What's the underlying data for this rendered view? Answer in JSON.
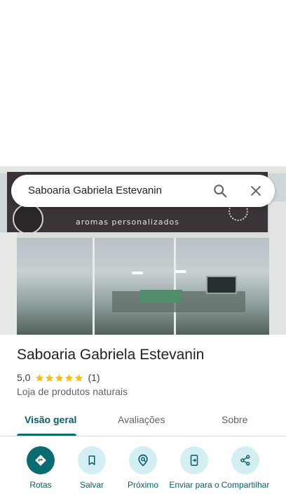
{
  "search": {
    "query": "Saboaria Gabriela Estevanin",
    "search_icon": "search-icon",
    "close_icon": "close-icon"
  },
  "photo": {
    "sign_text": "aromas personalizados"
  },
  "place": {
    "name": "Saboaria Gabriela Estevanin",
    "rating": "5,0",
    "stars": 5,
    "review_count": "(1)",
    "category": "Loja de produtos naturais"
  },
  "tabs": [
    {
      "label": "Visão geral",
      "active": true
    },
    {
      "label": "Avaliações",
      "active": false
    },
    {
      "label": "Sobre",
      "active": false
    }
  ],
  "actions": [
    {
      "label": "Rotas",
      "icon": "directions-icon"
    },
    {
      "label": "Salvar",
      "icon": "bookmark-icon"
    },
    {
      "label": "Próximo",
      "icon": "nearby-icon"
    },
    {
      "label": "Enviar para o",
      "icon": "send-to-phone-icon"
    },
    {
      "label": "Compartilhar",
      "icon": "share-icon"
    }
  ],
  "colors": {
    "accent": "#0b6b72",
    "accent_light": "#d4eff3",
    "star": "#fbbc04",
    "text": "#202124",
    "muted": "#5f6368"
  }
}
